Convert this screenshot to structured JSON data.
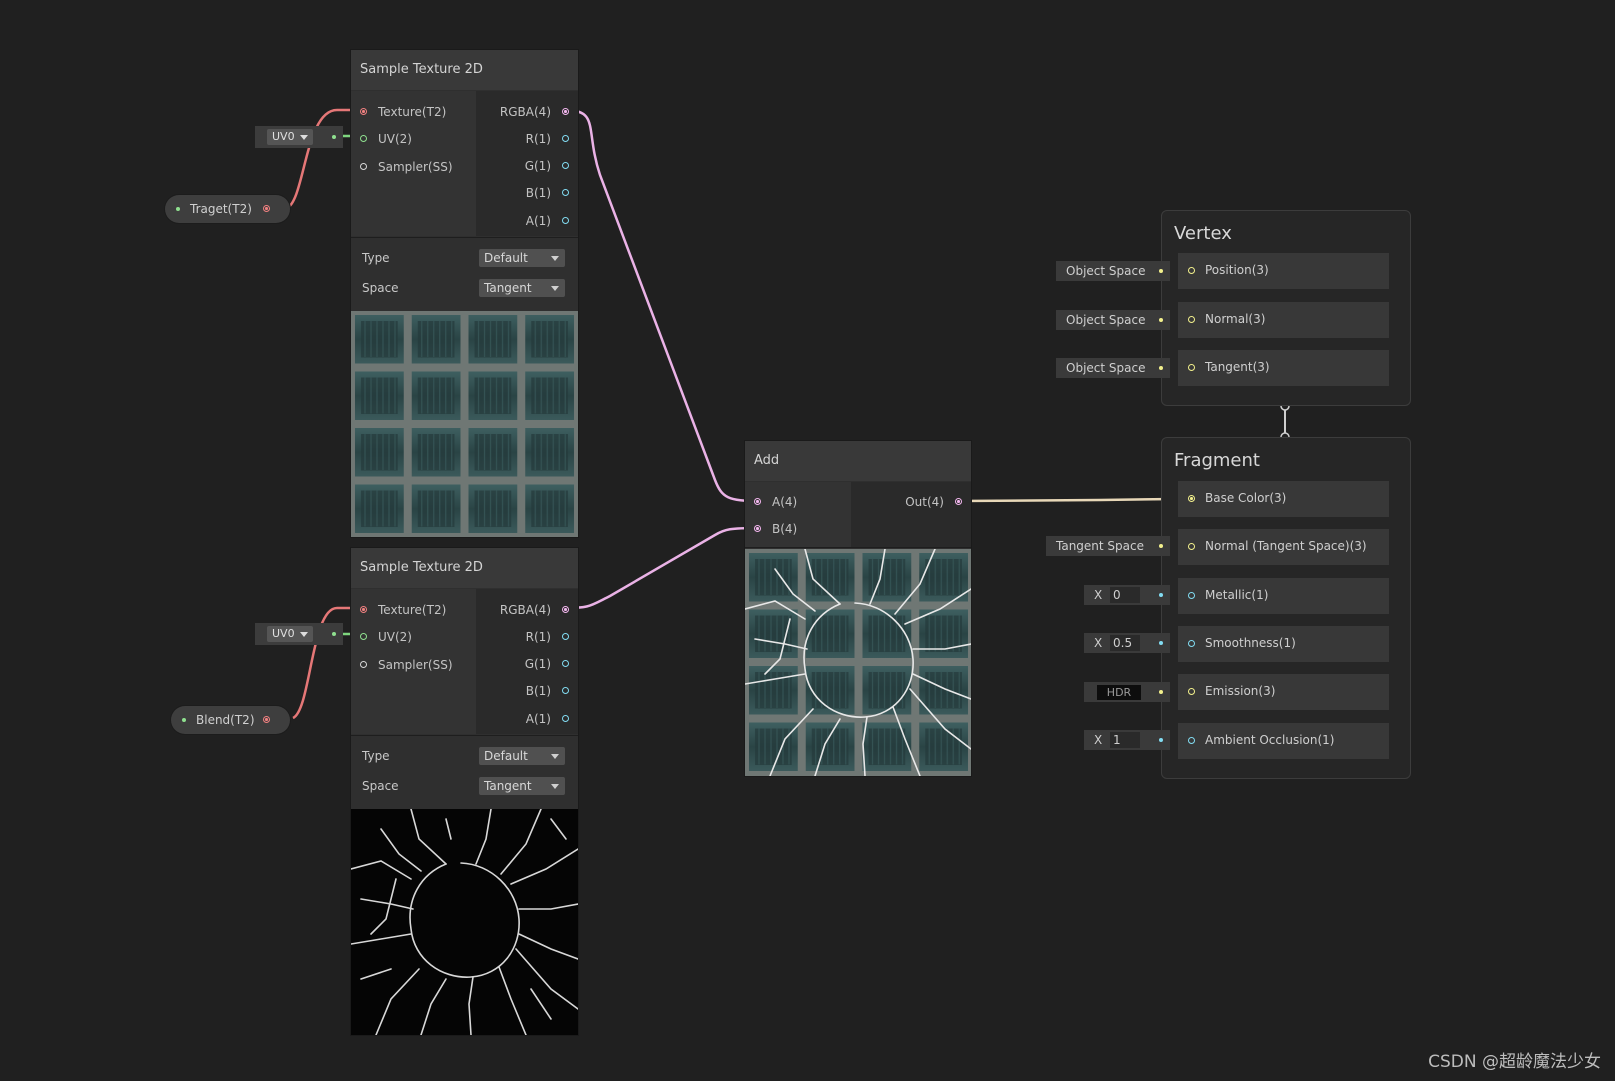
{
  "colors": {
    "background": "#202020",
    "texture_port": "#f08080",
    "uv_port": "#8fe08f",
    "vector4_port": "#f2b6ee",
    "vector1_port": "#82dcf2",
    "vector3_port": "#f2f08c"
  },
  "sample_top": {
    "title": "Sample Texture 2D",
    "inputs": [
      "Texture(T2)",
      "UV(2)",
      "Sampler(SS)"
    ],
    "outputs": [
      "RGBA(4)",
      "R(1)",
      "G(1)",
      "B(1)",
      "A(1)"
    ],
    "type_label": "Type",
    "type_value": "Default",
    "space_label": "Space",
    "space_value": "Tangent",
    "uv_value": "UV0"
  },
  "sample_bottom": {
    "title": "Sample Texture 2D",
    "inputs": [
      "Texture(T2)",
      "UV(2)",
      "Sampler(SS)"
    ],
    "outputs": [
      "RGBA(4)",
      "R(1)",
      "G(1)",
      "B(1)",
      "A(1)"
    ],
    "type_label": "Type",
    "type_value": "Default",
    "space_label": "Space",
    "space_value": "Tangent",
    "uv_value": "UV0"
  },
  "properties": {
    "traget": "Traget(T2)",
    "blend": "Blend(T2)"
  },
  "add_node": {
    "title": "Add",
    "inputs": [
      "A(4)",
      "B(4)"
    ],
    "output": "Out(4)"
  },
  "vertex": {
    "title": "Vertex",
    "blocks": [
      {
        "label": "Position(3)",
        "input": "Object Space"
      },
      {
        "label": "Normal(3)",
        "input": "Object Space"
      },
      {
        "label": "Tangent(3)",
        "input": "Object Space"
      }
    ]
  },
  "fragment": {
    "title": "Fragment",
    "blocks": [
      {
        "label": "Base Color(3)"
      },
      {
        "label": "Normal (Tangent Space)(3)",
        "input": "Tangent Space"
      },
      {
        "label": "Metallic(1)",
        "axis": "X",
        "value": "0"
      },
      {
        "label": "Smoothness(1)",
        "axis": "X",
        "value": "0.5"
      },
      {
        "label": "Emission(3)",
        "value": "HDR"
      },
      {
        "label": "Ambient Occlusion(1)",
        "axis": "X",
        "value": "1"
      }
    ]
  },
  "watermark": "CSDN @超龄魔法少女"
}
